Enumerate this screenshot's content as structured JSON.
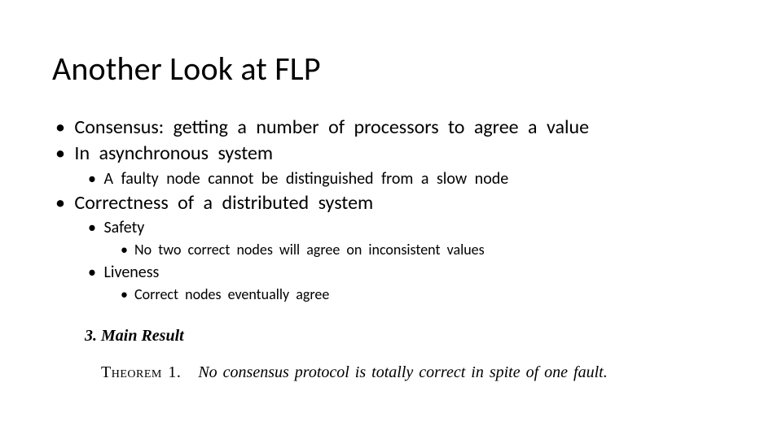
{
  "title": "Another Look at FLP",
  "bullets": {
    "consensus": "Consensus: getting a number of processors to agree a value",
    "async": "In asynchronous system",
    "async_sub": "A faulty node cannot be distinguished from a slow node",
    "correctness": "Correctness of a distributed system",
    "safety": "Safety",
    "safety_sub": "No two correct nodes will agree on inconsistent values",
    "liveness": "Liveness",
    "liveness_sub": "Correct nodes eventually agree"
  },
  "section": {
    "number": "3.",
    "name": "Main Result"
  },
  "theorem": {
    "label": "Theorem 1.",
    "text": "No consensus protocol is totally correct in spite of one fault."
  }
}
